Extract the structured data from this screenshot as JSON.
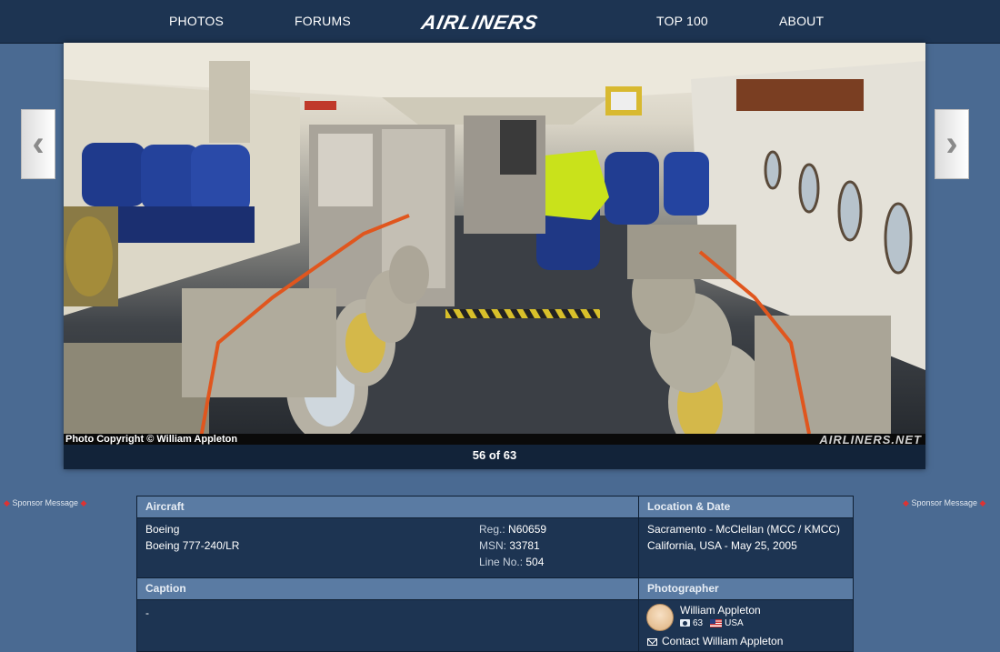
{
  "nav": {
    "photos": "PHOTOS",
    "forums": "FORUMS",
    "logo": "AIRLINERS",
    "top100": "TOP 100",
    "about": "ABOUT"
  },
  "photo": {
    "copyright": "Photo Copyright © William Appleton",
    "watermark": "AIRLINERS.NET",
    "counter": "56 of 63"
  },
  "arrows": {
    "prev_icon": "chevron-left-icon",
    "next_icon": "chevron-right-icon"
  },
  "sponsor": {
    "left": "Sponsor Message",
    "right": "Sponsor Message"
  },
  "aircraft": {
    "header": "Aircraft",
    "manufacturer": "Boeing",
    "model": "Boeing 777-240/LR",
    "reg_label": "Reg.:",
    "reg_value": "N60659",
    "msn_label": "MSN:",
    "msn_value": "33781",
    "line_label": "Line No.:",
    "line_value": "504"
  },
  "location": {
    "header": "Location & Date",
    "place": "Sacramento - McClellan (MCC / KMCC)",
    "region_date": "California, USA - May 25, 2005"
  },
  "caption": {
    "header": "Caption",
    "text": "-"
  },
  "photographer": {
    "header": "Photographer",
    "name": "William Appleton",
    "photo_count": "63",
    "country": "USA",
    "contact": "Contact William Appleton"
  },
  "colors": {
    "background": "#4a6a92",
    "nav_bg": "#1d3452",
    "header_bg": "#5a7ba3"
  }
}
